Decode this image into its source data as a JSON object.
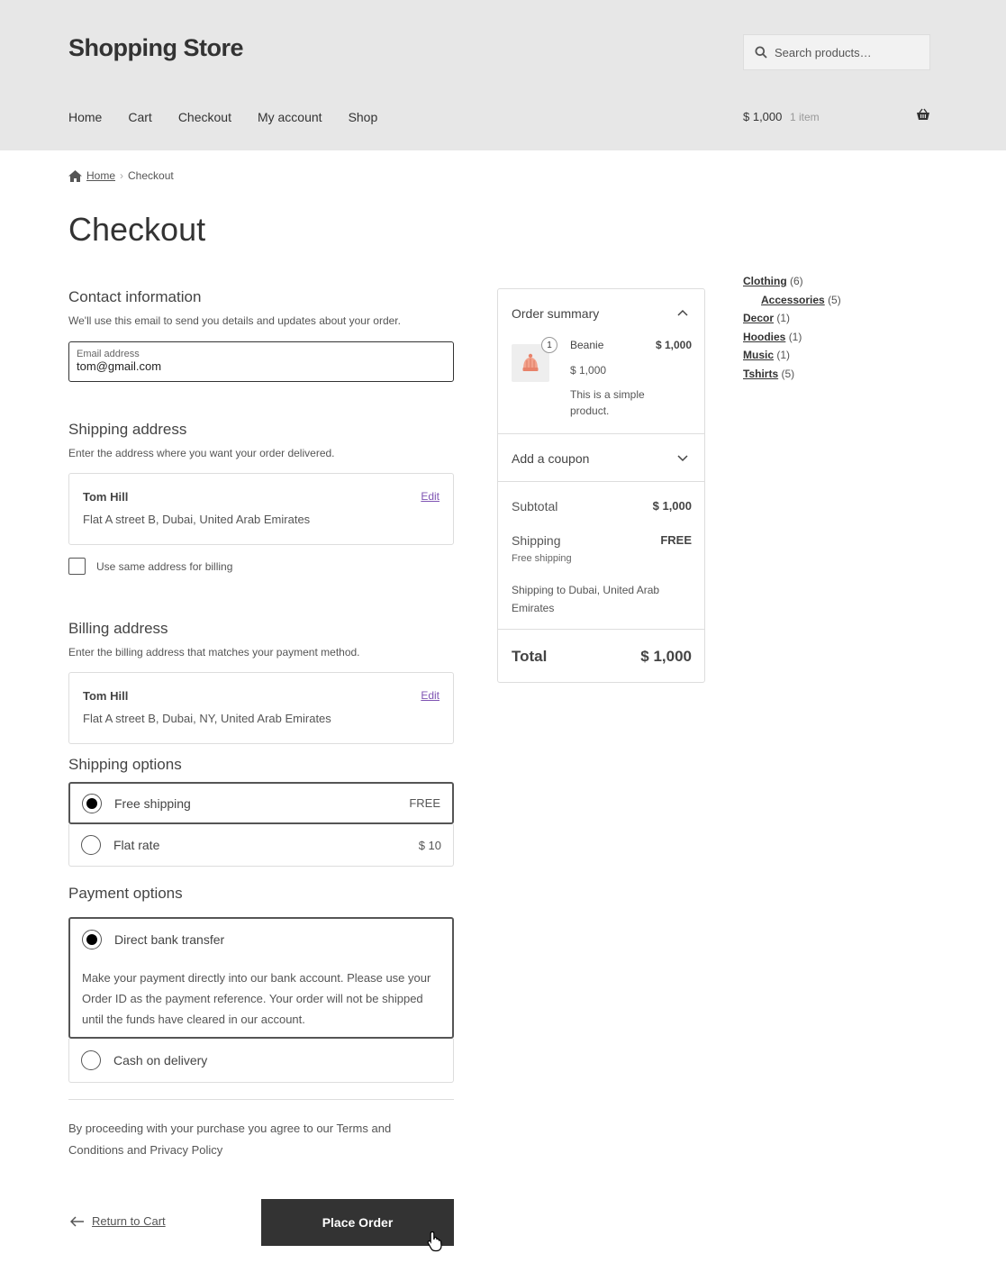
{
  "header": {
    "site_title": "Shopping Store",
    "search_placeholder": "Search products…",
    "nav": [
      "Home",
      "Cart",
      "Checkout",
      "My account",
      "Shop"
    ],
    "cart_total": "$ 1,000",
    "cart_count": "1 item"
  },
  "breadcrumb": {
    "home": "Home",
    "current": "Checkout"
  },
  "page_title": "Checkout",
  "contact": {
    "title": "Contact information",
    "desc": "We'll use this email to send you details and updates about your order.",
    "email_label": "Email address",
    "email_value": "tom@gmail.com"
  },
  "shipping_address": {
    "title": "Shipping address",
    "desc": "Enter the address where you want your order delivered.",
    "name": "Tom Hill",
    "line": "Flat A street B, Dubai, United Arab Emirates",
    "edit": "Edit",
    "same_billing_label": "Use same address for billing"
  },
  "billing_address": {
    "title": "Billing address",
    "desc": "Enter the billing address that matches your payment method.",
    "name": "Tom Hill",
    "line": "Flat A street B, Dubai, NY, United Arab Emirates",
    "edit": "Edit"
  },
  "shipping_options": {
    "title": "Shipping options",
    "items": [
      {
        "label": "Free shipping",
        "price": "FREE",
        "selected": true
      },
      {
        "label": "Flat rate",
        "price": "$ 10",
        "selected": false
      }
    ]
  },
  "payment_options": {
    "title": "Payment options",
    "bank": {
      "label": "Direct bank transfer",
      "desc": "Make your payment directly into our bank account. Please use your Order ID as the payment reference. Your order will not be shipped until the funds have cleared in our account."
    },
    "cod": {
      "label": "Cash on delivery"
    }
  },
  "terms": "By proceeding with your purchase you agree to our Terms and Conditions and Privacy Policy",
  "return_label": "Return to Cart",
  "place_order": "Place Order",
  "summary": {
    "title": "Order summary",
    "item": {
      "qty": "1",
      "name": "Beanie",
      "total": "$ 1,000",
      "price": "$ 1,000",
      "desc": "This is a simple product."
    },
    "coupon": "Add a coupon",
    "subtotal_label": "Subtotal",
    "subtotal": "$ 1,000",
    "shipping_label": "Shipping",
    "shipping_value": "FREE",
    "shipping_method": "Free shipping",
    "shipping_to": "Shipping to Dubai, United Arab Emirates",
    "total_label": "Total",
    "total": "$ 1,000"
  },
  "categories": [
    {
      "name": "Clothing",
      "count": "(6)",
      "sub": false
    },
    {
      "name": "Accessories",
      "count": "(5)",
      "sub": true
    },
    {
      "name": "Decor",
      "count": "(1)",
      "sub": false
    },
    {
      "name": "Hoodies",
      "count": "(1)",
      "sub": false
    },
    {
      "name": "Music",
      "count": "(1)",
      "sub": false
    },
    {
      "name": "Tshirts",
      "count": "(5)",
      "sub": false
    }
  ],
  "colors": {
    "header_bg": "#e7e7e7",
    "button_bg": "#333333",
    "edit_link": "#7f54b3"
  }
}
